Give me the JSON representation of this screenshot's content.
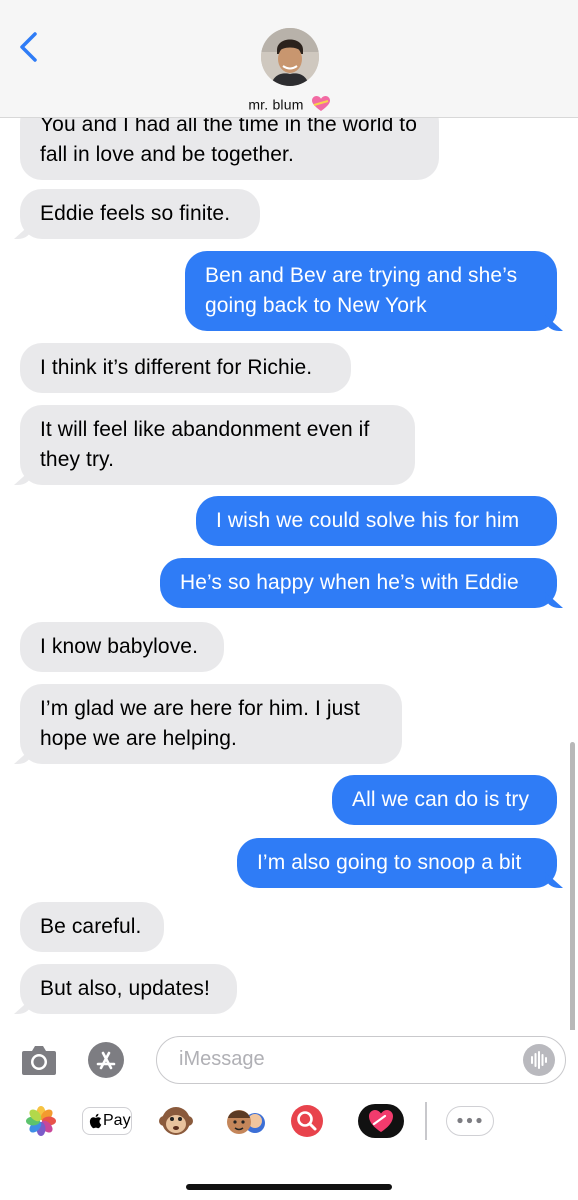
{
  "header": {
    "back_label": "Back",
    "contact_name": "mr. blum"
  },
  "messages": [
    {
      "side": "recv",
      "text": "You and I had all the time in the world to fall in love and be together."
    },
    {
      "side": "recv",
      "text": "Eddie feels so finite."
    },
    {
      "side": "sent",
      "text": "Ben and Bev are trying and she’s going back to New York"
    },
    {
      "side": "recv",
      "text": "I think it’s different for Richie."
    },
    {
      "side": "recv",
      "text": "It will feel like abandonment even if they try."
    },
    {
      "side": "sent",
      "text": "I wish we could solve his for him"
    },
    {
      "side": "sent",
      "text": "He’s so happy when he’s with Eddie"
    },
    {
      "side": "recv",
      "text": "I know babylove."
    },
    {
      "side": "recv",
      "text": "I’m glad we are here for him. I just hope we are helping."
    },
    {
      "side": "sent",
      "text": "All we can do is try"
    },
    {
      "side": "sent",
      "text": "I’m also going to snoop a bit"
    },
    {
      "side": "recv",
      "text": "Be careful."
    },
    {
      "side": "recv",
      "text": "But also, updates!"
    }
  ],
  "input": {
    "placeholder": "iMessage"
  },
  "apps": {
    "pay_label": "Pay",
    "items": [
      "photos-icon",
      "apple-pay-icon",
      "monkey-memoji-icon",
      "memoji-stickers-icon",
      "image-search-icon",
      "digital-touch-icon",
      "more-apps-icon"
    ]
  },
  "colors": {
    "sent_bubble": "#2f7cf6",
    "recv_bubble": "#e9e9eb",
    "accent": "#2f7cf6"
  }
}
